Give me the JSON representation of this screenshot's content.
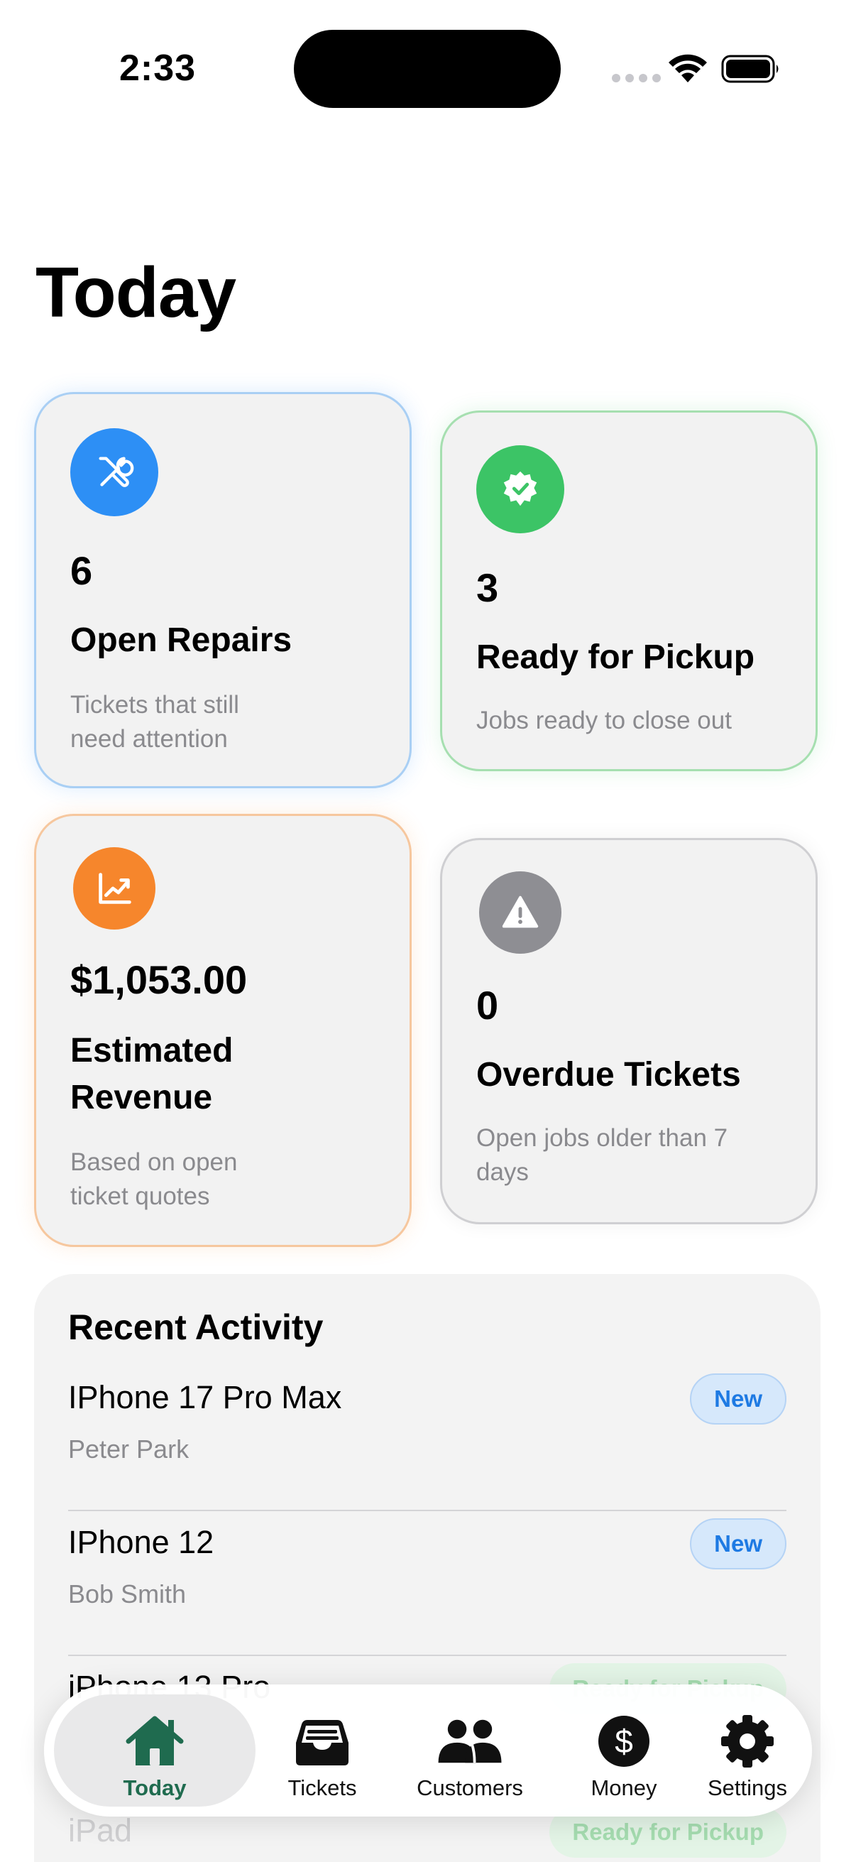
{
  "status_bar": {
    "time": "2:33"
  },
  "page": {
    "title": "Today"
  },
  "stats": {
    "open_repairs": {
      "value": "6",
      "label": "Open Repairs",
      "description": "Tickets that still need attention",
      "icon": "wrench-screwdriver-icon",
      "color": "#2d8ff5"
    },
    "ready_for_pickup": {
      "value": "3",
      "label": "Ready for Pickup",
      "description": "Jobs ready to close out",
      "icon": "checkmark-seal-icon",
      "color": "#3cc466"
    },
    "estimated_revenue": {
      "value": "$1,053.00",
      "label": "Estimated Revenue",
      "description": "Based on open ticket quotes",
      "icon": "chart-up-icon",
      "color": "#f6862c"
    },
    "overdue_tickets": {
      "value": "0",
      "label": "Overdue Tickets",
      "description": "Open jobs older than 7 days",
      "icon": "warning-triangle-icon",
      "color": "#8e8e93"
    }
  },
  "recent_activity": {
    "title": "Recent Activity",
    "items": [
      {
        "device": "IPhone 17 Pro Max",
        "customer": "Peter Park",
        "status": "New"
      },
      {
        "device": "IPhone 12",
        "customer": "Bob Smith",
        "status": "New"
      },
      {
        "device": "iPhone 13 Pro",
        "customer": "",
        "status": "Ready for Pickup"
      },
      {
        "device": "iPad",
        "customer": "",
        "status": "Ready for Pickup"
      }
    ]
  },
  "tab_bar": {
    "tabs": [
      {
        "label": "Today",
        "icon": "house-icon",
        "active": true
      },
      {
        "label": "Tickets",
        "icon": "tray-icon",
        "active": false
      },
      {
        "label": "Customers",
        "icon": "people-icon",
        "active": false
      },
      {
        "label": "Money",
        "icon": "dollar-circle-icon",
        "active": false
      },
      {
        "label": "Settings",
        "icon": "gear-icon",
        "active": false
      }
    ],
    "accent_color": "#1f6b4f"
  }
}
